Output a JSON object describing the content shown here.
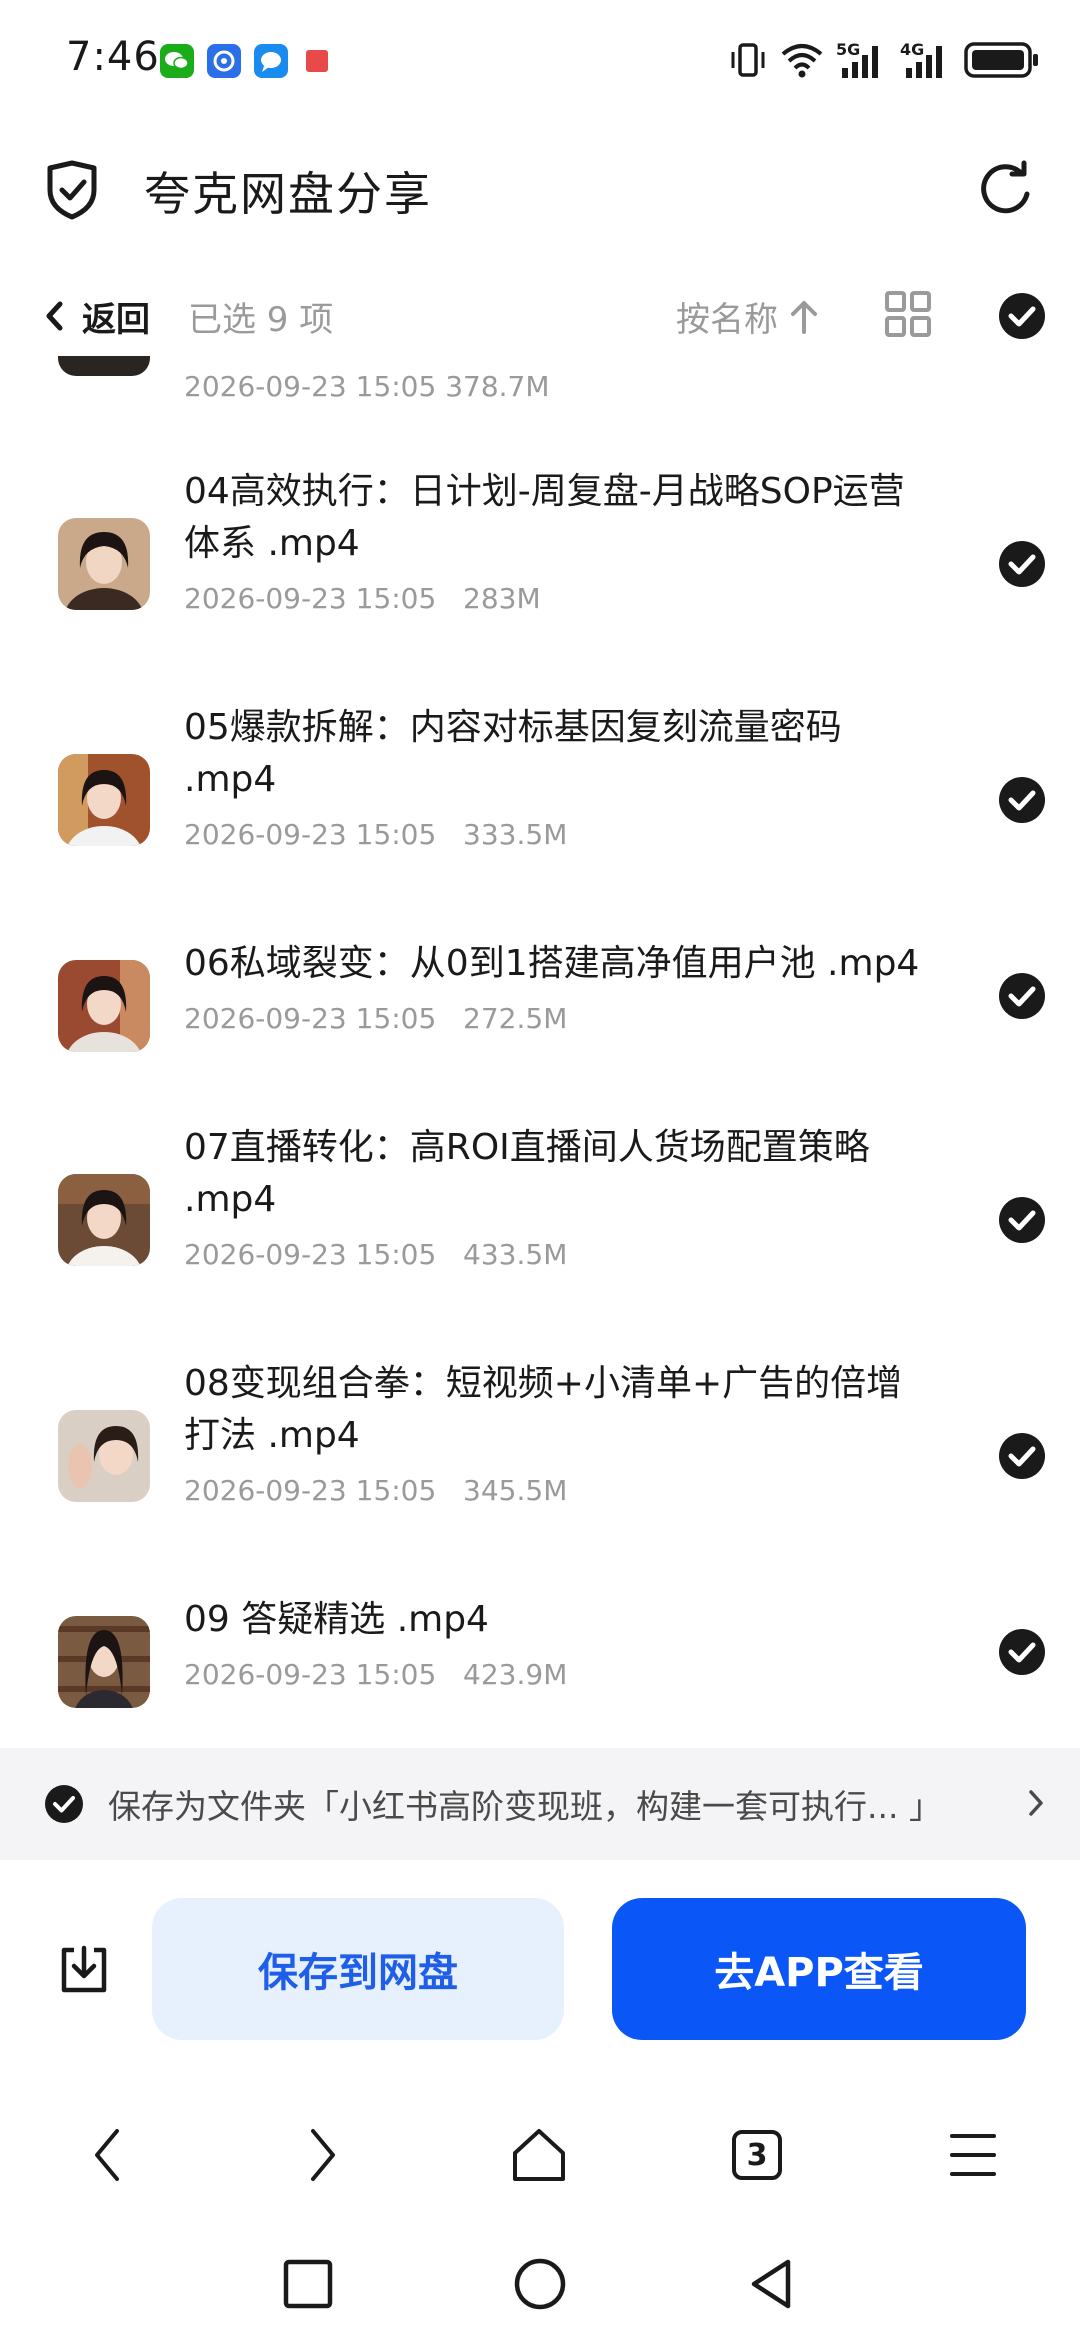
{
  "status_bar": {
    "time": "7:46",
    "network_5g": "5G",
    "network_4g": "4G"
  },
  "header": {
    "title": "夸克网盘分享"
  },
  "toolbar": {
    "back_label": "返回",
    "selected_count": "已选 9 项",
    "sort_label": "按名称"
  },
  "files": {
    "partial_meta": "2026-09-23 15:05   378.7M",
    "items": [
      {
        "name": "04高效执行：日计划-周复盘-月战略SOP运营体系 .mp4",
        "date": "2026-09-23 15:05",
        "size": "283M"
      },
      {
        "name": "05爆款拆解：内容对标基因复刻流量密码 .mp4",
        "date": "2026-09-23 15:05",
        "size": "333.5M"
      },
      {
        "name": "06私域裂变：从0到1搭建高净值用户池 .mp4",
        "date": "2026-09-23 15:05",
        "size": "272.5M"
      },
      {
        "name": "07直播转化：高ROI直播间人货场配置策略 .mp4",
        "date": "2026-09-23 15:05",
        "size": "433.5M"
      },
      {
        "name": "08变现组合拳：短视频+小清单+广告的倍增打法 .mp4",
        "date": "2026-09-23 15:05",
        "size": "345.5M"
      },
      {
        "name": "09 答疑精选 .mp4",
        "date": "2026-09-23 15:05",
        "size": "423.9M"
      }
    ]
  },
  "save_as": {
    "text": "保存为文件夹「小红书高阶变现班，构建一套可执行... 」"
  },
  "actions": {
    "save_label": "保存到网盘",
    "open_app_label": "去APP查看"
  },
  "browser_nav": {
    "tabs_count": "3"
  },
  "colors": {
    "primary": "#0a56f7",
    "save_button_bg": "#e7f0fd",
    "save_button_text": "#1f5ee8",
    "muted_text": "#9a9a9a"
  }
}
